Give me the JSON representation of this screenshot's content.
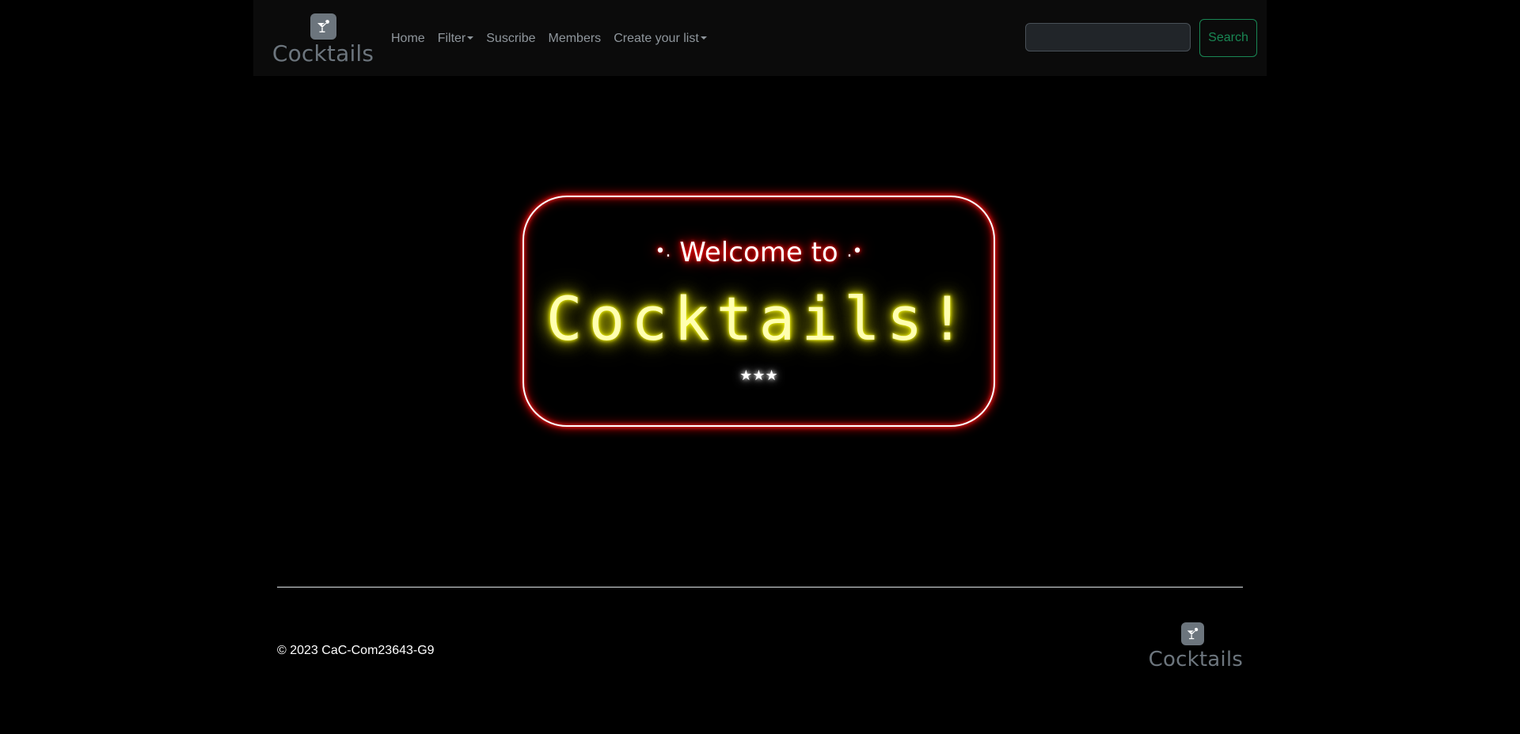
{
  "navbar": {
    "brand": {
      "icon": "cocktail-glass-icon",
      "text": "Cocktails"
    },
    "links": [
      {
        "label": "Home",
        "dropdown": false
      },
      {
        "label": "Filter",
        "dropdown": true
      },
      {
        "label": "Suscribe",
        "dropdown": false
      },
      {
        "label": "Members",
        "dropdown": false
      },
      {
        "label": "Create your list",
        "dropdown": true
      }
    ],
    "search": {
      "value": "",
      "placeholder": "",
      "button_label": "Search"
    }
  },
  "hero": {
    "welcome_prefix": "•.",
    "welcome_text": "Welcome to",
    "welcome_suffix": ".•",
    "title": "Cocktails!",
    "stars": "★★★"
  },
  "footer": {
    "copyright": "© 2023 CaC-Com23643-G9",
    "brand": {
      "icon": "cocktail-glass-icon",
      "text": "Cocktails"
    }
  },
  "colors": {
    "background": "#000000",
    "navbar": "#0b0b0b",
    "muted": "#6c757d",
    "search_accent": "#198754",
    "neon_red": "#ff0000",
    "neon_yellow": "#ffff00"
  }
}
